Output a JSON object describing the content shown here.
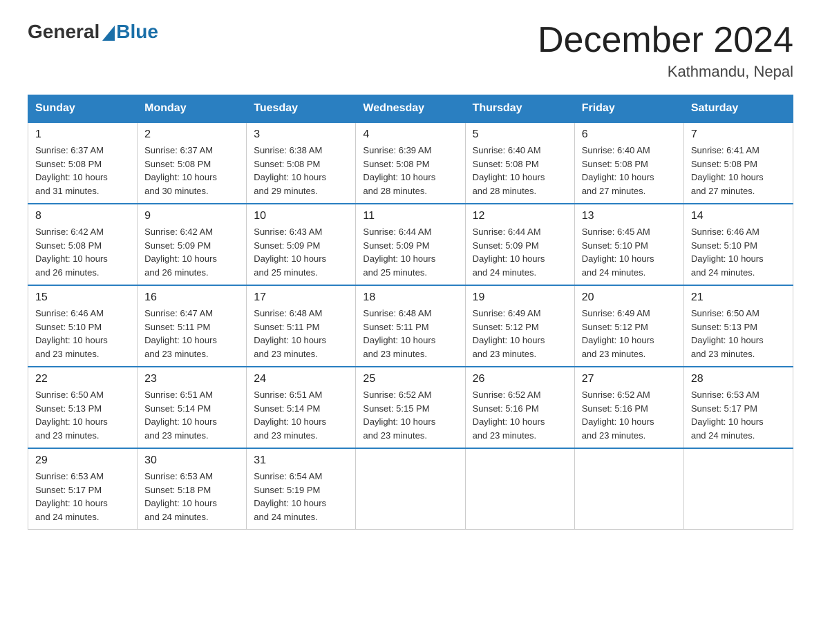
{
  "logo": {
    "general": "General",
    "blue": "Blue"
  },
  "header": {
    "month_year": "December 2024",
    "location": "Kathmandu, Nepal"
  },
  "days_of_week": [
    "Sunday",
    "Monday",
    "Tuesday",
    "Wednesday",
    "Thursday",
    "Friday",
    "Saturday"
  ],
  "weeks": [
    [
      {
        "day": "1",
        "sunrise": "6:37 AM",
        "sunset": "5:08 PM",
        "daylight": "10 hours and 31 minutes."
      },
      {
        "day": "2",
        "sunrise": "6:37 AM",
        "sunset": "5:08 PM",
        "daylight": "10 hours and 30 minutes."
      },
      {
        "day": "3",
        "sunrise": "6:38 AM",
        "sunset": "5:08 PM",
        "daylight": "10 hours and 29 minutes."
      },
      {
        "day": "4",
        "sunrise": "6:39 AM",
        "sunset": "5:08 PM",
        "daylight": "10 hours and 28 minutes."
      },
      {
        "day": "5",
        "sunrise": "6:40 AM",
        "sunset": "5:08 PM",
        "daylight": "10 hours and 28 minutes."
      },
      {
        "day": "6",
        "sunrise": "6:40 AM",
        "sunset": "5:08 PM",
        "daylight": "10 hours and 27 minutes."
      },
      {
        "day": "7",
        "sunrise": "6:41 AM",
        "sunset": "5:08 PM",
        "daylight": "10 hours and 27 minutes."
      }
    ],
    [
      {
        "day": "8",
        "sunrise": "6:42 AM",
        "sunset": "5:08 PM",
        "daylight": "10 hours and 26 minutes."
      },
      {
        "day": "9",
        "sunrise": "6:42 AM",
        "sunset": "5:09 PM",
        "daylight": "10 hours and 26 minutes."
      },
      {
        "day": "10",
        "sunrise": "6:43 AM",
        "sunset": "5:09 PM",
        "daylight": "10 hours and 25 minutes."
      },
      {
        "day": "11",
        "sunrise": "6:44 AM",
        "sunset": "5:09 PM",
        "daylight": "10 hours and 25 minutes."
      },
      {
        "day": "12",
        "sunrise": "6:44 AM",
        "sunset": "5:09 PM",
        "daylight": "10 hours and 24 minutes."
      },
      {
        "day": "13",
        "sunrise": "6:45 AM",
        "sunset": "5:10 PM",
        "daylight": "10 hours and 24 minutes."
      },
      {
        "day": "14",
        "sunrise": "6:46 AM",
        "sunset": "5:10 PM",
        "daylight": "10 hours and 24 minutes."
      }
    ],
    [
      {
        "day": "15",
        "sunrise": "6:46 AM",
        "sunset": "5:10 PM",
        "daylight": "10 hours and 23 minutes."
      },
      {
        "day": "16",
        "sunrise": "6:47 AM",
        "sunset": "5:11 PM",
        "daylight": "10 hours and 23 minutes."
      },
      {
        "day": "17",
        "sunrise": "6:48 AM",
        "sunset": "5:11 PM",
        "daylight": "10 hours and 23 minutes."
      },
      {
        "day": "18",
        "sunrise": "6:48 AM",
        "sunset": "5:11 PM",
        "daylight": "10 hours and 23 minutes."
      },
      {
        "day": "19",
        "sunrise": "6:49 AM",
        "sunset": "5:12 PM",
        "daylight": "10 hours and 23 minutes."
      },
      {
        "day": "20",
        "sunrise": "6:49 AM",
        "sunset": "5:12 PM",
        "daylight": "10 hours and 23 minutes."
      },
      {
        "day": "21",
        "sunrise": "6:50 AM",
        "sunset": "5:13 PM",
        "daylight": "10 hours and 23 minutes."
      }
    ],
    [
      {
        "day": "22",
        "sunrise": "6:50 AM",
        "sunset": "5:13 PM",
        "daylight": "10 hours and 23 minutes."
      },
      {
        "day": "23",
        "sunrise": "6:51 AM",
        "sunset": "5:14 PM",
        "daylight": "10 hours and 23 minutes."
      },
      {
        "day": "24",
        "sunrise": "6:51 AM",
        "sunset": "5:14 PM",
        "daylight": "10 hours and 23 minutes."
      },
      {
        "day": "25",
        "sunrise": "6:52 AM",
        "sunset": "5:15 PM",
        "daylight": "10 hours and 23 minutes."
      },
      {
        "day": "26",
        "sunrise": "6:52 AM",
        "sunset": "5:16 PM",
        "daylight": "10 hours and 23 minutes."
      },
      {
        "day": "27",
        "sunrise": "6:52 AM",
        "sunset": "5:16 PM",
        "daylight": "10 hours and 23 minutes."
      },
      {
        "day": "28",
        "sunrise": "6:53 AM",
        "sunset": "5:17 PM",
        "daylight": "10 hours and 24 minutes."
      }
    ],
    [
      {
        "day": "29",
        "sunrise": "6:53 AM",
        "sunset": "5:17 PM",
        "daylight": "10 hours and 24 minutes."
      },
      {
        "day": "30",
        "sunrise": "6:53 AM",
        "sunset": "5:18 PM",
        "daylight": "10 hours and 24 minutes."
      },
      {
        "day": "31",
        "sunrise": "6:54 AM",
        "sunset": "5:19 PM",
        "daylight": "10 hours and 24 minutes."
      },
      null,
      null,
      null,
      null
    ]
  ],
  "labels": {
    "sunrise": "Sunrise:",
    "sunset": "Sunset:",
    "daylight": "Daylight:"
  }
}
